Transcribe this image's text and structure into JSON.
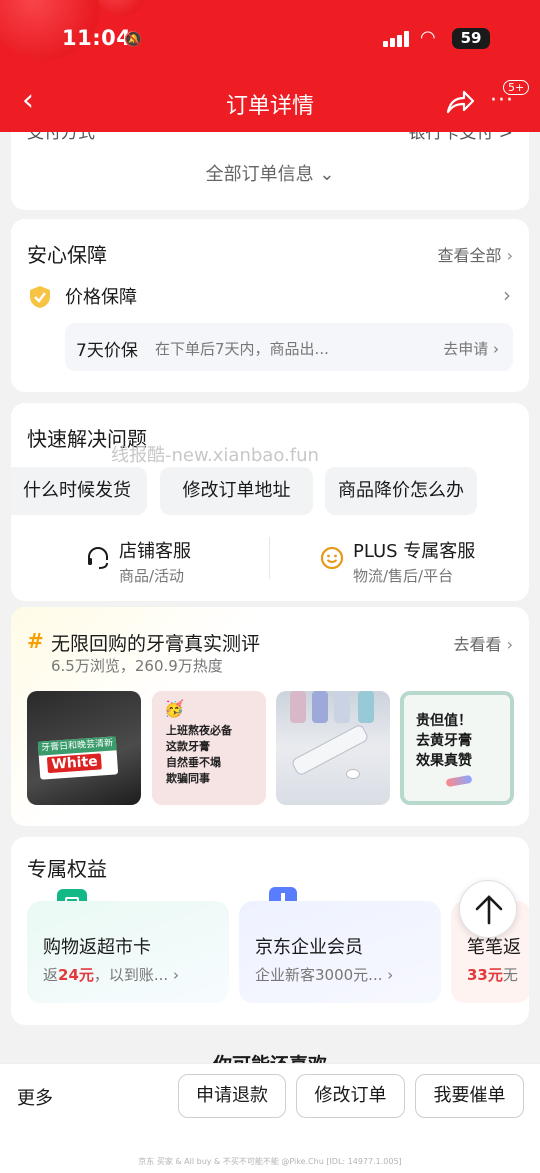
{
  "status_bar": {
    "time": "11:04",
    "battery": "59"
  },
  "nav": {
    "title": "订单详情",
    "badge": "5+"
  },
  "order_info": {
    "cut_left": "支付方式",
    "cut_right": "银行卡支付 >",
    "all_info_label": "全部订单信息 ⌄"
  },
  "guarantee": {
    "title": "安心保障",
    "view_all": "查看全部",
    "price_guard": "价格保障",
    "box_label": "7天价保",
    "box_desc": "在下单后7天内，商品出...",
    "box_action": "去申请"
  },
  "quick": {
    "title": "快速解决问题",
    "watermark": "线报酷-new.xianbao.fun",
    "chips": [
      "什么时候发货",
      "修改订单地址",
      "商品降价怎么办"
    ],
    "services": [
      {
        "name": "店铺客服",
        "sub": "商品/活动"
      },
      {
        "name": "PLUS 专属客服",
        "sub": "物流/售后/平台"
      }
    ]
  },
  "topic": {
    "title": "无限回购的牙膏真实测评",
    "stats": "6.5万浏览，260.9万热度",
    "action": "去看看",
    "thumb1_top": "牙膏日和晚芸清新",
    "thumb1_word": "White",
    "thumb2_lines": [
      "上班熬夜必备",
      "这款牙膏",
      "自然垂不塌",
      "欺骗同事"
    ],
    "thumb4_lines": [
      "贵但值！",
      "去黄牙膏",
      "效果真赞"
    ]
  },
  "benefits": {
    "title": "专属权益",
    "items": [
      {
        "title": "购物返超市卡",
        "desc_pre": "返",
        "desc_hl": "24元",
        "desc_post": "，以到账..."
      },
      {
        "title": "京东企业会员",
        "desc_pre": "企业新客3000元...",
        "desc_hl": "",
        "desc_post": ""
      },
      {
        "title": "笔笔返",
        "desc_pre": "",
        "desc_hl": "33元",
        "desc_post": "无"
      }
    ]
  },
  "recommend_title": "你可能还喜欢",
  "bottom": {
    "more": "更多",
    "buttons": [
      "申请退款",
      "修改订单",
      "我要催单"
    ],
    "footer_note": "京东 买家 & All buy & 不买不可能不能 @Pike.Chu [IDL: 14977.1.005]"
  },
  "colors": {
    "brand_red": "#ee1d23",
    "price_red": "#e4393c",
    "hash_gold": "#f5a000"
  }
}
